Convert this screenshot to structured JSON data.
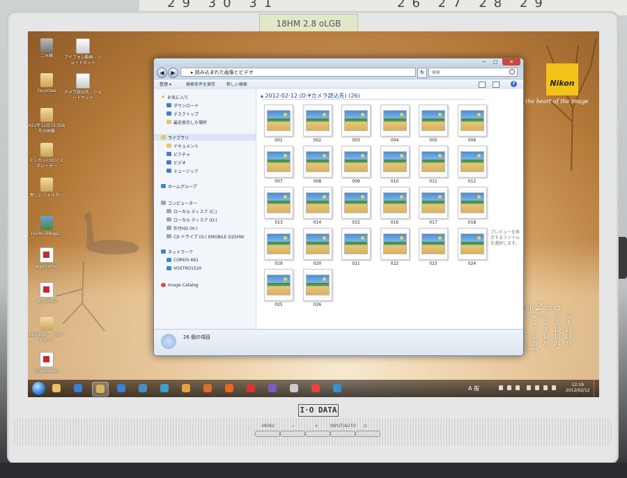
{
  "room": {
    "calendar_row_left": "29 30 31",
    "calendar_row_right": "26 27 28 29",
    "sticky_note": "18HM 2.8 oLGB",
    "monitor_brand": "I·O DATA",
    "bezel_buttons": [
      "MENU",
      "−",
      "+",
      "INPUT/AUTO",
      "⏻"
    ]
  },
  "wallpaper": {
    "logo": "Nikon",
    "slogan": "the heart of the image",
    "copyright": "Copyright © 2012 Nikon Corporation All rights Reserved"
  },
  "desktop_icons": [
    {
      "label": "ごみ箱",
      "icon": "recycle-bin-icon",
      "kind": "bin"
    },
    {
      "label": "アイフォン動画 - ショートカット",
      "icon": "shortcut-icon",
      "kind": "app"
    },
    {
      "label": "Favorites",
      "icon": "folder-icon",
      "kind": "folder"
    },
    {
      "label": "カメラ読込先 - ショートカット",
      "icon": "shortcut-icon",
      "kind": "app"
    },
    {
      "label": "H22年12月13 日出先の画像",
      "icon": "folder-icon",
      "kind": "folder"
    },
    {
      "label": "ミシガンCSSジ ェネレーター",
      "icon": "folder-icon",
      "kind": "folder"
    },
    {
      "label": "新しいフォルダー",
      "icon": "folder-icon",
      "kind": "folder"
    },
    {
      "label": "1024x768ug2...",
      "icon": "image-icon",
      "kind": "photo"
    },
    {
      "label": "application",
      "icon": "pdf-icon",
      "kind": "pdf"
    },
    {
      "label": "eb_20042",
      "icon": "pdf-icon",
      "kind": "pdf"
    },
    {
      "label": "Uploader - ショートカット",
      "icon": "folder-icon",
      "kind": "folder"
    },
    {
      "label": "Graduation",
      "icon": "pdf-icon",
      "kind": "pdf"
    }
  ],
  "calendar_gadget": {
    "month": "Feb",
    "day": "2",
    "year": "2012",
    "weekdays": [
      "Sun",
      "Mon",
      "Tue",
      "Wed",
      "Thu",
      "Fri",
      "Sat"
    ],
    "days": [
      "",
      "",
      "",
      "1",
      "2",
      "3",
      "4",
      "5",
      "6",
      "7",
      "8",
      "9",
      "10",
      "11",
      "12",
      "13",
      "14",
      "15",
      "16",
      "17",
      "18",
      "19",
      "20",
      "21",
      "22",
      "23",
      "24",
      "25",
      "26",
      "27",
      "28",
      "29",
      "",
      "",
      ""
    ]
  },
  "explorer": {
    "title_buttons": {
      "minimize": "─",
      "maximize": "□",
      "close": "✕"
    },
    "back": "◀",
    "forward": "▶",
    "address": "▸ 読み込まれた画像とビデオ",
    "refresh": "↻",
    "search_placeholder": "検索",
    "toolbar": {
      "organize": "整理 ▾",
      "save_search": "検索条件を保存",
      "new_folder": "新しい検索",
      "help": "?"
    },
    "nav": {
      "favorites": "お気に入り",
      "downloads": "ダウンロード",
      "desktop": "デスクトップ",
      "recent": "最近表示した場所",
      "libraries": "ライブラリ",
      "documents": "ドキュメント",
      "pictures": "ピクチャ",
      "videos": "ビデオ",
      "music": "ミュージック",
      "homegroup": "ホームグループ",
      "computer": "コンピューター",
      "drive_c": "ローカル ディスク (C:)",
      "drive_d": "ローカル ディスク (D:)",
      "drive_h": "外付HD (H:)",
      "drive_cd": "CD ドライブ (O:) EMOBILE D25HW",
      "network": "ネットワーク",
      "net_1": "COREI5-661",
      "net_2": "VOSTRO1520",
      "image_catalog": "Image Catalog"
    },
    "group_header": "▴ 2012-02-12 (D:¥カメラ読込先) (26)",
    "files": [
      "001",
      "002",
      "003",
      "004",
      "005",
      "006",
      "007",
      "008",
      "009",
      "010",
      "011",
      "012",
      "013",
      "014",
      "015",
      "016",
      "017",
      "018",
      "019",
      "020",
      "021",
      "022",
      "023",
      "024",
      "025",
      "026"
    ],
    "preview_hint": "プレビューを表示するファイルを選択します。",
    "status": "26 個の項目"
  },
  "taskbar": {
    "apps": [
      "explorer-icon",
      "ie-icon",
      "folder-icon",
      "media-player-icon",
      "paint-icon",
      "network-icon",
      "image-viewer-icon",
      "audio-icon",
      "firefox-icon",
      "asf-icon",
      "picasa-icon",
      "tool-icon",
      "chrome-icon",
      "globe-icon"
    ],
    "ime": "A 般",
    "time": "12:19",
    "date": "2012/02/12"
  }
}
